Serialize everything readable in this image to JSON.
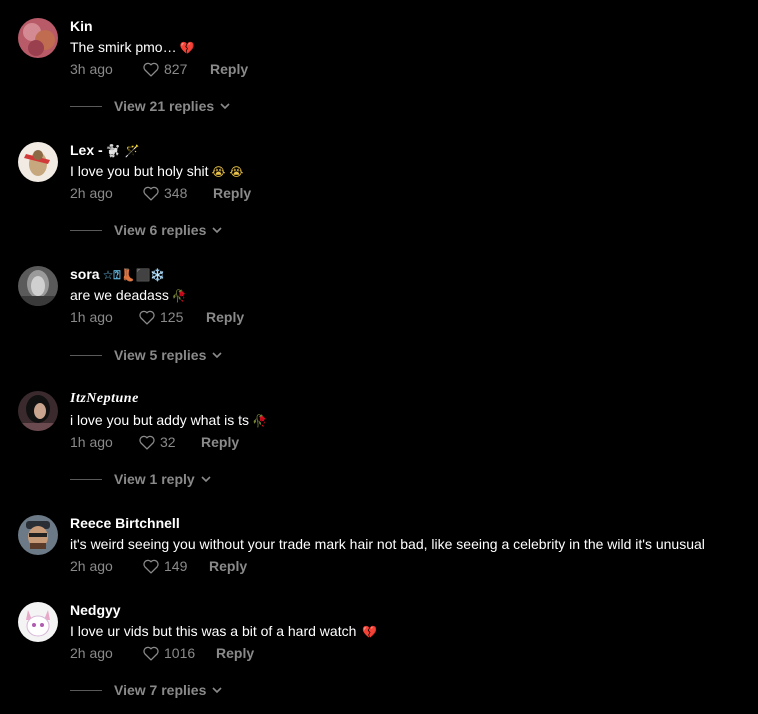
{
  "colors": {
    "background": "#000000",
    "text": "#ffffff",
    "muted": "#8a8a8a",
    "heart_red": "#d9393e",
    "snowflake": "#6cc4f0"
  },
  "comments": [
    {
      "username": "Kin",
      "text": "The smirk pmo…",
      "text_emoji": "💔",
      "time": "3h ago",
      "likes": "827",
      "reply_label": "Reply",
      "view_replies": "View 21 replies"
    },
    {
      "username": "Lex -",
      "username_extra": "🐩 🪄",
      "text": "I love you but holy shit",
      "text_emoji": "😭 😭",
      "time": "2h ago",
      "likes": "348",
      "reply_label": "Reply",
      "view_replies": "View 6 replies"
    },
    {
      "username": "sora",
      "username_extra": "☆⍰👢⬛❄️",
      "text": "are we deadass",
      "text_emoji": "🥀",
      "time": "1h ago",
      "likes": "125",
      "reply_label": "Reply",
      "view_replies": "View 5 replies"
    },
    {
      "username": "ItzNeptune",
      "text": "i love you but addy what is ts",
      "text_emoji": "🥀",
      "time": "1h ago",
      "likes": "32",
      "reply_label": "Reply",
      "view_replies": "View 1 reply"
    },
    {
      "username": "Reece Birtchnell",
      "text": "it's weird seeing you without your trade mark hair not bad, like seeing a celebrity in the wild it's unusual",
      "time": "2h ago",
      "likes": "149",
      "reply_label": "Reply"
    },
    {
      "username": "Nedgyy",
      "text": "I love ur vids but this was a bit of a hard watch",
      "text_emoji": "💔",
      "time": "2h ago",
      "likes": "1016",
      "reply_label": "Reply",
      "view_replies": "View 7 replies"
    }
  ]
}
